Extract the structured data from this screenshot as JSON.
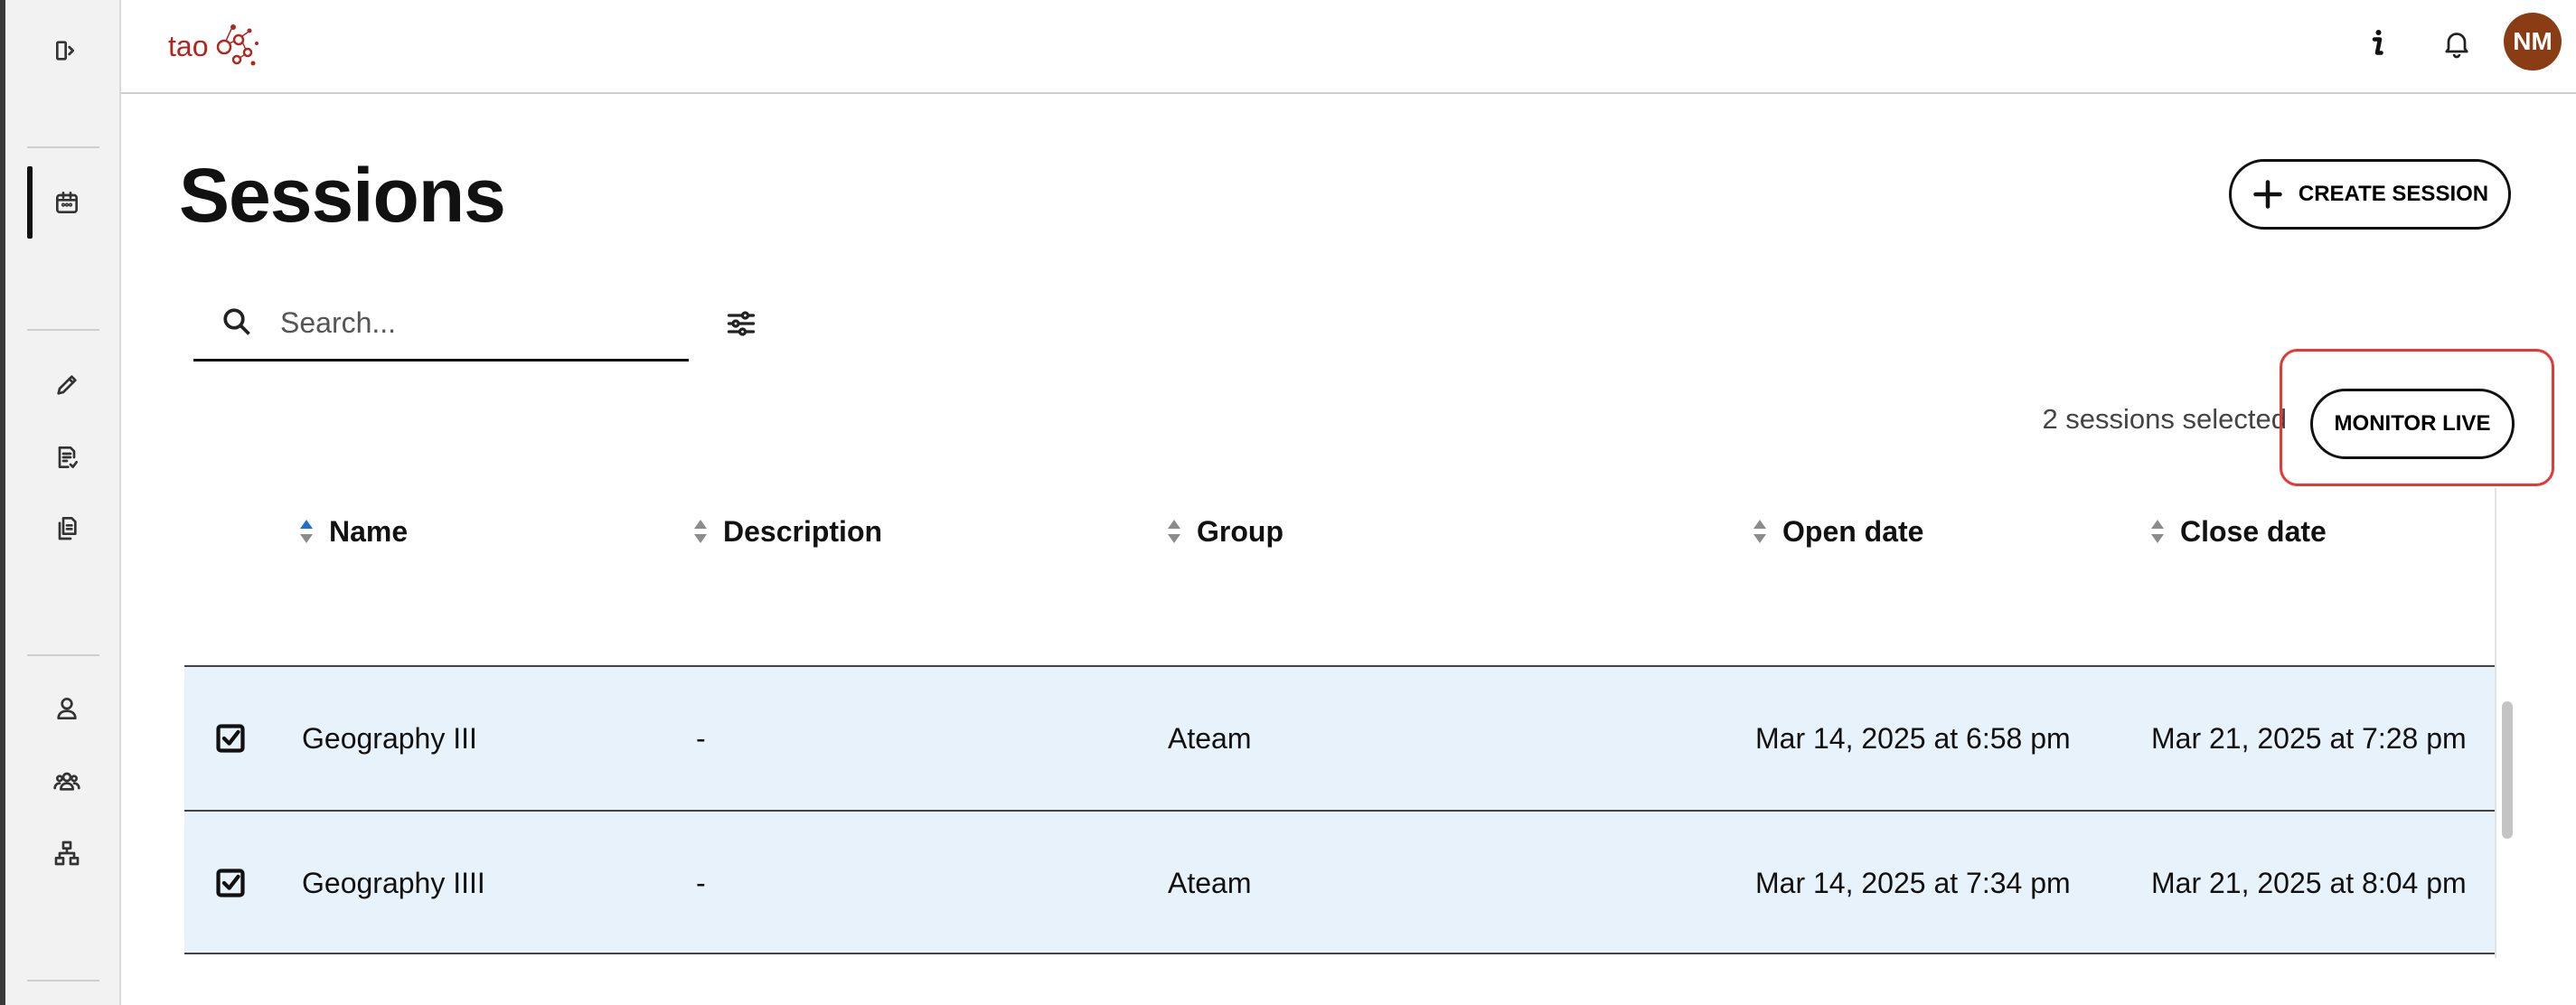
{
  "app": {
    "logo_text": "tao"
  },
  "sidebar": {
    "items": [
      {
        "name": "collapse-sidebar-icon"
      },
      {
        "name": "sessions-calendar-icon",
        "active": true
      },
      {
        "name": "edit-pencil-icon"
      },
      {
        "name": "tests-checklist-icon"
      },
      {
        "name": "results-documents-icon"
      },
      {
        "name": "user-icon"
      },
      {
        "name": "groups-icon"
      },
      {
        "name": "hierarchy-icon"
      }
    ]
  },
  "topbar": {
    "info_icon": "info-icon",
    "notifications_icon": "bell-icon",
    "avatar_initials": "NM",
    "avatar_color": "#8a3d14"
  },
  "page": {
    "title": "Sessions",
    "create_button_label": "CREATE SESSION",
    "search_placeholder": "Search...",
    "search_value": "",
    "selection_text": "2 sessions selected",
    "monitor_button_label": "MONITOR LIVE",
    "highlight_color": "#e53935"
  },
  "table": {
    "columns": [
      "Name",
      "Description",
      "Group",
      "Open date",
      "Close date"
    ],
    "sorted_column": "Name",
    "sort_direction": "ascending",
    "rows": [
      {
        "selected": true,
        "name": "Geography III",
        "description": "-",
        "group": "Ateam",
        "open_date": "Mar 14, 2025 at 6:58 pm",
        "close_date": "Mar 21, 2025 at 7:28 pm"
      },
      {
        "selected": true,
        "name": "Geography IIII",
        "description": "-",
        "group": "Ateam",
        "open_date": "Mar 14, 2025 at 7:34 pm",
        "close_date": "Mar 21, 2025 at 8:04 pm"
      }
    ],
    "row_selected_color": "#e8f2fb"
  }
}
